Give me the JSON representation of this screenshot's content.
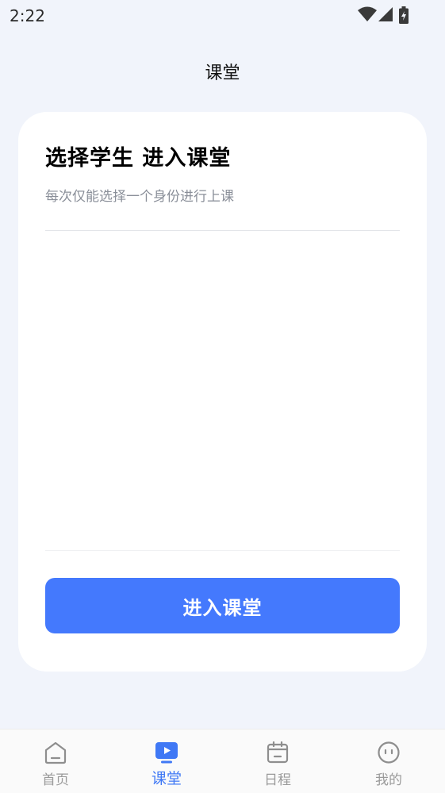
{
  "status_bar": {
    "time": "2:22"
  },
  "header": {
    "title": "课堂"
  },
  "card": {
    "title": "选择学生 进入课堂",
    "subtitle": "每次仅能选择一个身份进行上课",
    "button_label": "进入课堂"
  },
  "tabs": [
    {
      "label": "首页",
      "icon": "home-icon",
      "active": false
    },
    {
      "label": "课堂",
      "icon": "classroom-play-icon",
      "active": true
    },
    {
      "label": "日程",
      "icon": "calendar-icon",
      "active": false
    },
    {
      "label": "我的",
      "icon": "profile-face-icon",
      "active": false
    }
  ],
  "colors": {
    "accent": "#4479fd",
    "active_tab": "#3f78f5",
    "inactive_tab": "#9a9a9a",
    "background": "#f1f4fb"
  }
}
